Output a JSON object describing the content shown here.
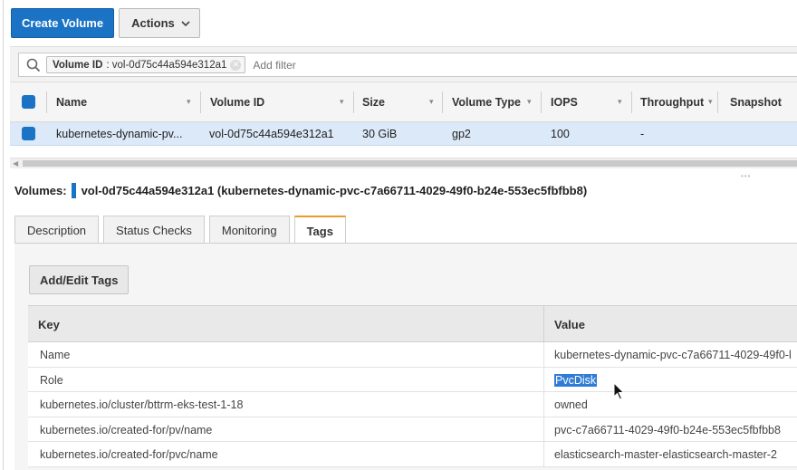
{
  "toolbar": {
    "create_label": "Create Volume",
    "actions_label": "Actions"
  },
  "filter": {
    "token_key": "Volume ID",
    "token_value": ": vol-0d75c44a594e312a1",
    "placeholder": "Add filter"
  },
  "volumes_table": {
    "headers": {
      "name": "Name",
      "volume_id": "Volume ID",
      "size": "Size",
      "volume_type": "Volume Type",
      "iops": "IOPS",
      "throughput": "Throughput",
      "snapshot": "Snapshot"
    },
    "row": {
      "name": "kubernetes-dynamic-pv...",
      "volume_id": "vol-0d75c44a594e312a1",
      "size": "30 GiB",
      "volume_type": "gp2",
      "iops": "100",
      "throughput": "-"
    }
  },
  "selection": {
    "prefix": "Volumes:",
    "title": "vol-0d75c44a594e312a1 (kubernetes-dynamic-pvc-c7a66711-4029-49f0-b24e-553ec5fbfbb8)"
  },
  "tabs": [
    "Description",
    "Status Checks",
    "Monitoring",
    "Tags"
  ],
  "active_tab": "Tags",
  "tags_panel": {
    "edit_button": "Add/Edit Tags",
    "key_header": "Key",
    "value_header": "Value",
    "rows": [
      {
        "key": "Name",
        "value": "kubernetes-dynamic-pvc-c7a66711-4029-49f0-l"
      },
      {
        "key": "Role",
        "value": "PvcDisk"
      },
      {
        "key": "kubernetes.io/cluster/bttrm-eks-test-1-18",
        "value": "owned"
      },
      {
        "key": "kubernetes.io/created-for/pv/name",
        "value": "pvc-c7a66711-4029-49f0-b24e-553ec5fbfbb8"
      },
      {
        "key": "kubernetes.io/created-for/pvc/name",
        "value": "elasticsearch-master-elasticsearch-master-2"
      }
    ]
  },
  "colors": {
    "primary": "#1a73c4",
    "selected_row": "#dbe9f8",
    "active_tab_accent": "#e89c2b",
    "text_highlight": "#2f7bd6"
  },
  "icons": {
    "search": "search-icon",
    "dropdown": "chevron-down-icon",
    "remove_token": "close-icon",
    "cursor": "mouse-pointer-icon"
  }
}
